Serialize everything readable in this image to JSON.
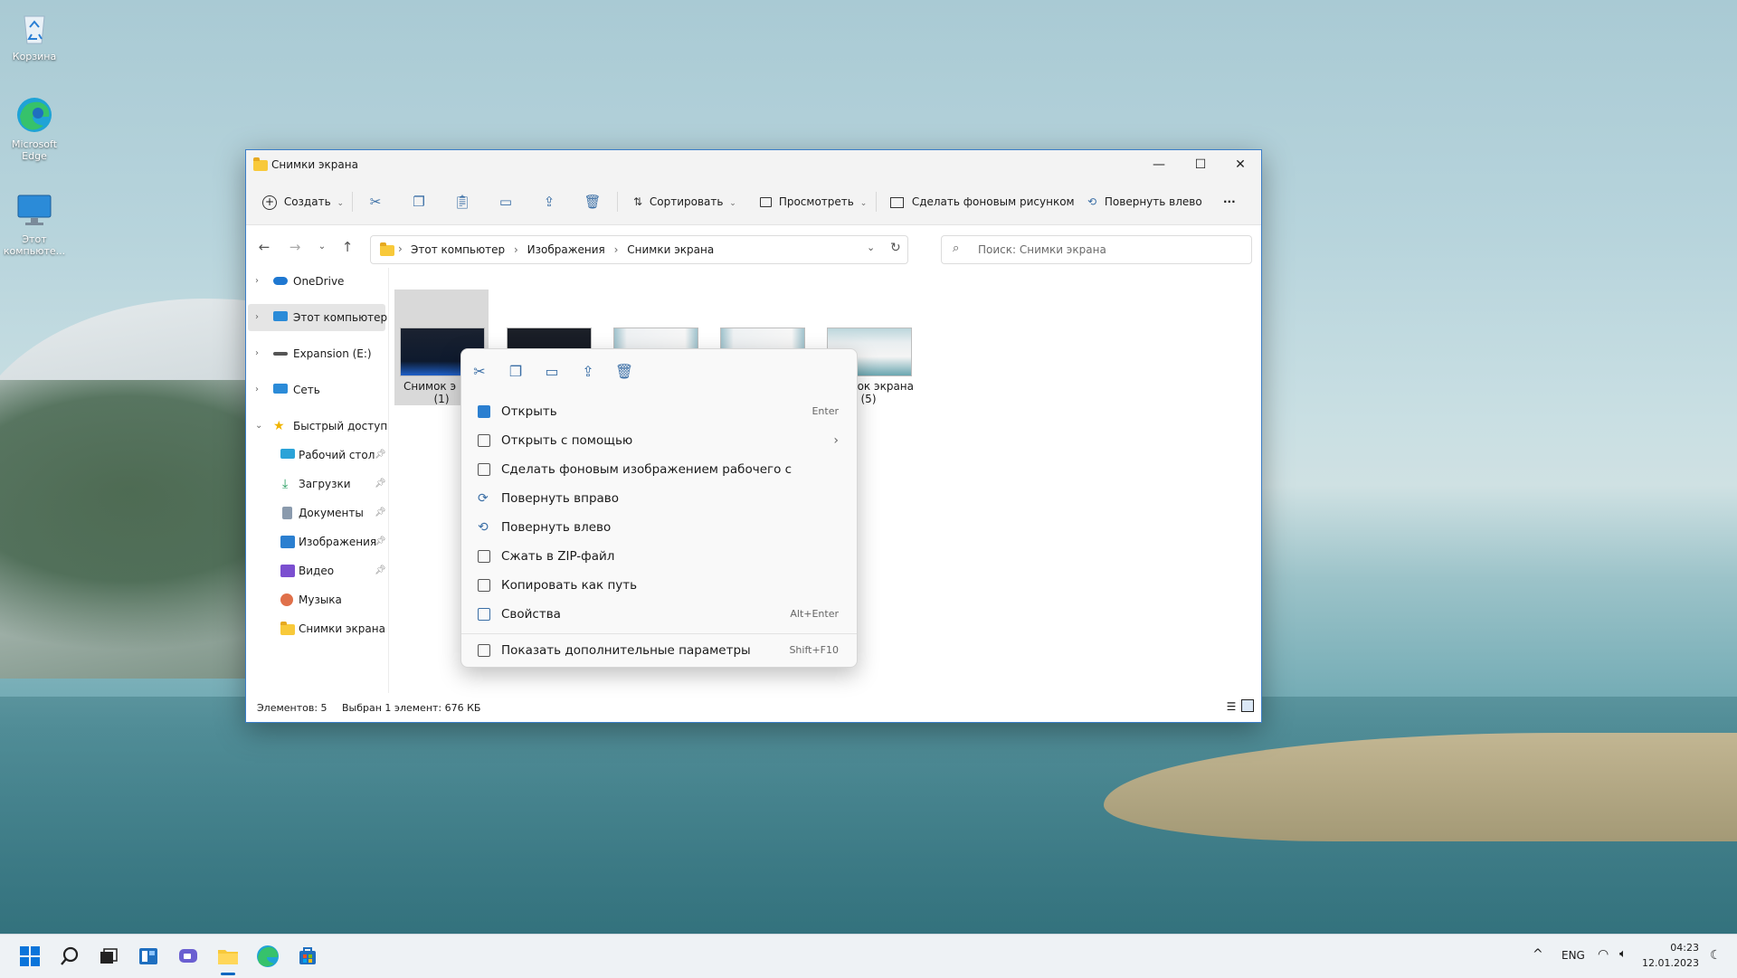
{
  "desktop": {
    "icons": [
      {
        "label": "Корзина"
      },
      {
        "label": "Microsoft Edge"
      },
      {
        "label": "Этот компьюте..."
      }
    ]
  },
  "window": {
    "title": "Снимки экрана",
    "controls": {
      "minimize": "—",
      "maximize": "☐",
      "close": "✕"
    }
  },
  "toolbar": {
    "create_label": "Создать",
    "sort_label": "Сортировать",
    "view_label": "Просмотреть",
    "set_background_label": "Сделать фоновым рисунком",
    "rotate_left_label": "Повернуть влево",
    "more_label": "···"
  },
  "address": {
    "crumbs": [
      "Этот компьютер",
      "Изображения",
      "Снимки экрана"
    ],
    "separator": "›"
  },
  "search": {
    "placeholder": "Поиск: Снимки экрана"
  },
  "nav": {
    "items": [
      {
        "label": "OneDrive",
        "chevron": "›"
      },
      {
        "label": "Этот компьютер",
        "chevron": "›"
      },
      {
        "label": "Expansion (E:)",
        "chevron": "›"
      },
      {
        "label": "Сеть",
        "chevron": "›"
      },
      {
        "label": "Быстрый доступ",
        "chevron": "⌄"
      },
      {
        "label": "Рабочий стол"
      },
      {
        "label": "Загрузки"
      },
      {
        "label": "Документы"
      },
      {
        "label": "Изображения"
      },
      {
        "label": "Видео"
      },
      {
        "label": "Музыка"
      },
      {
        "label": "Снимки экрана"
      }
    ]
  },
  "files": [
    {
      "caption_line1": "Снимок э",
      "caption_line2": "(1)"
    },
    {
      "caption_line1": "",
      "caption_line2": ""
    },
    {
      "caption_line1": "",
      "caption_line2": ""
    },
    {
      "caption_line1": "",
      "caption_line2": ""
    },
    {
      "caption_line1": "мок экрана",
      "caption_line2": "(5)"
    }
  ],
  "status": {
    "items_count": "Элементов: 5",
    "selection": "Выбран 1 элемент: 676 КБ"
  },
  "context_menu": {
    "items": [
      {
        "label": "Открыть",
        "shortcut": "Enter"
      },
      {
        "label": "Открыть с помощью",
        "shortcut": "›"
      },
      {
        "label": "Сделать фоновым изображением рабочего с",
        "shortcut": ""
      },
      {
        "label": "Повернуть вправо",
        "shortcut": ""
      },
      {
        "label": "Повернуть влево",
        "shortcut": ""
      },
      {
        "label": "Сжать в ZIP-файл",
        "shortcut": ""
      },
      {
        "label": "Копировать как путь",
        "shortcut": ""
      },
      {
        "label": "Свойства",
        "shortcut": "Alt+Enter"
      }
    ],
    "more": {
      "label": "Показать дополнительные параметры",
      "shortcut": "Shift+F10"
    }
  },
  "taskbar": {
    "lang": "ENG",
    "time": "04:23",
    "date": "12.01.2023",
    "tray_up": "^"
  },
  "colors": {
    "accent": "#0067c0",
    "folder": "#f8c93a"
  }
}
